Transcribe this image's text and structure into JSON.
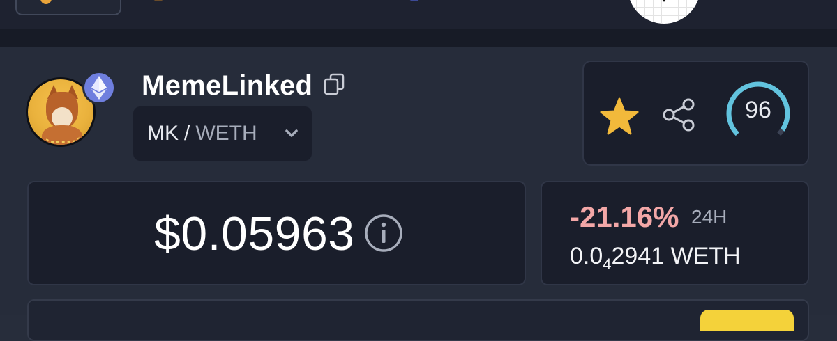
{
  "token": {
    "name": "MemeLinked",
    "pair_base": "MK",
    "pair_separator": "/",
    "pair_quote": "WETH",
    "chain_icon": "ethereum-icon"
  },
  "price": {
    "usd": "$0.05963"
  },
  "change": {
    "percent": "-21.16%",
    "period": "24H",
    "weth_prefix": "0.0",
    "weth_subscript": "4",
    "weth_digits": "2941",
    "weth_unit": "WETH"
  },
  "score": {
    "value": "96",
    "fraction": 0.96
  },
  "icons": {
    "copy": "copy-icon",
    "chevron": "chevron-down-icon",
    "favorite": "star-icon",
    "share": "share-icon",
    "info": "info-icon"
  },
  "colors": {
    "background": "#262c3a",
    "card": "#1a1e2b",
    "negative": "#f3a7a7",
    "star": "#f2b93b",
    "gauge": "#62c3de",
    "ethereum": "#6f7fde"
  }
}
